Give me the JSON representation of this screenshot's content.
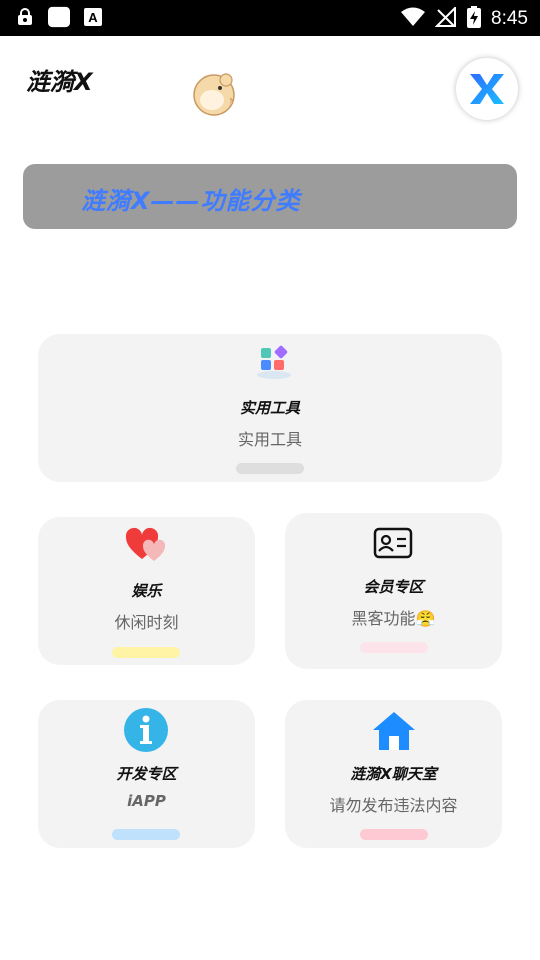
{
  "status_bar": {
    "time": "8:45",
    "icons": [
      "lock-icon",
      "app-square-icon",
      "font-a-icon",
      "wifi-icon",
      "no-signal-icon",
      "battery-charging-icon"
    ]
  },
  "header": {
    "app_title": "涟漪X",
    "mascot_icon": "hamster-mascot-icon",
    "logo_icon": "x-logo-icon"
  },
  "banner": {
    "text": "涟漪X——功能分类"
  },
  "cards": {
    "tools": {
      "title": "实用工具",
      "subtitle": "实用工具",
      "icon": "app-blocks-icon",
      "pill_color": "#dedede"
    },
    "entertainment": {
      "title": "娱乐",
      "subtitle": "休闲时刻",
      "icon": "hearts-icon",
      "pill_color": "#fff3a6"
    },
    "member": {
      "title": "会员专区",
      "subtitle": "黑客功能😤",
      "icon": "id-card-icon",
      "pill_color": "#fde3ea"
    },
    "developer": {
      "title": "开发专区",
      "subtitle": "iAPP",
      "icon": "info-icon",
      "pill_color": "#bfe1fb"
    },
    "chat": {
      "title": "涟漪X聊天室",
      "subtitle": "请勿发布违法内容",
      "icon": "home-icon",
      "pill_color": "#ffc9d3"
    }
  },
  "colors": {
    "banner_bg": "#9c9c9c",
    "banner_text": "#3f7cff",
    "card_bg": "#f3f3f3",
    "accent_blue": "#1d8cff"
  }
}
